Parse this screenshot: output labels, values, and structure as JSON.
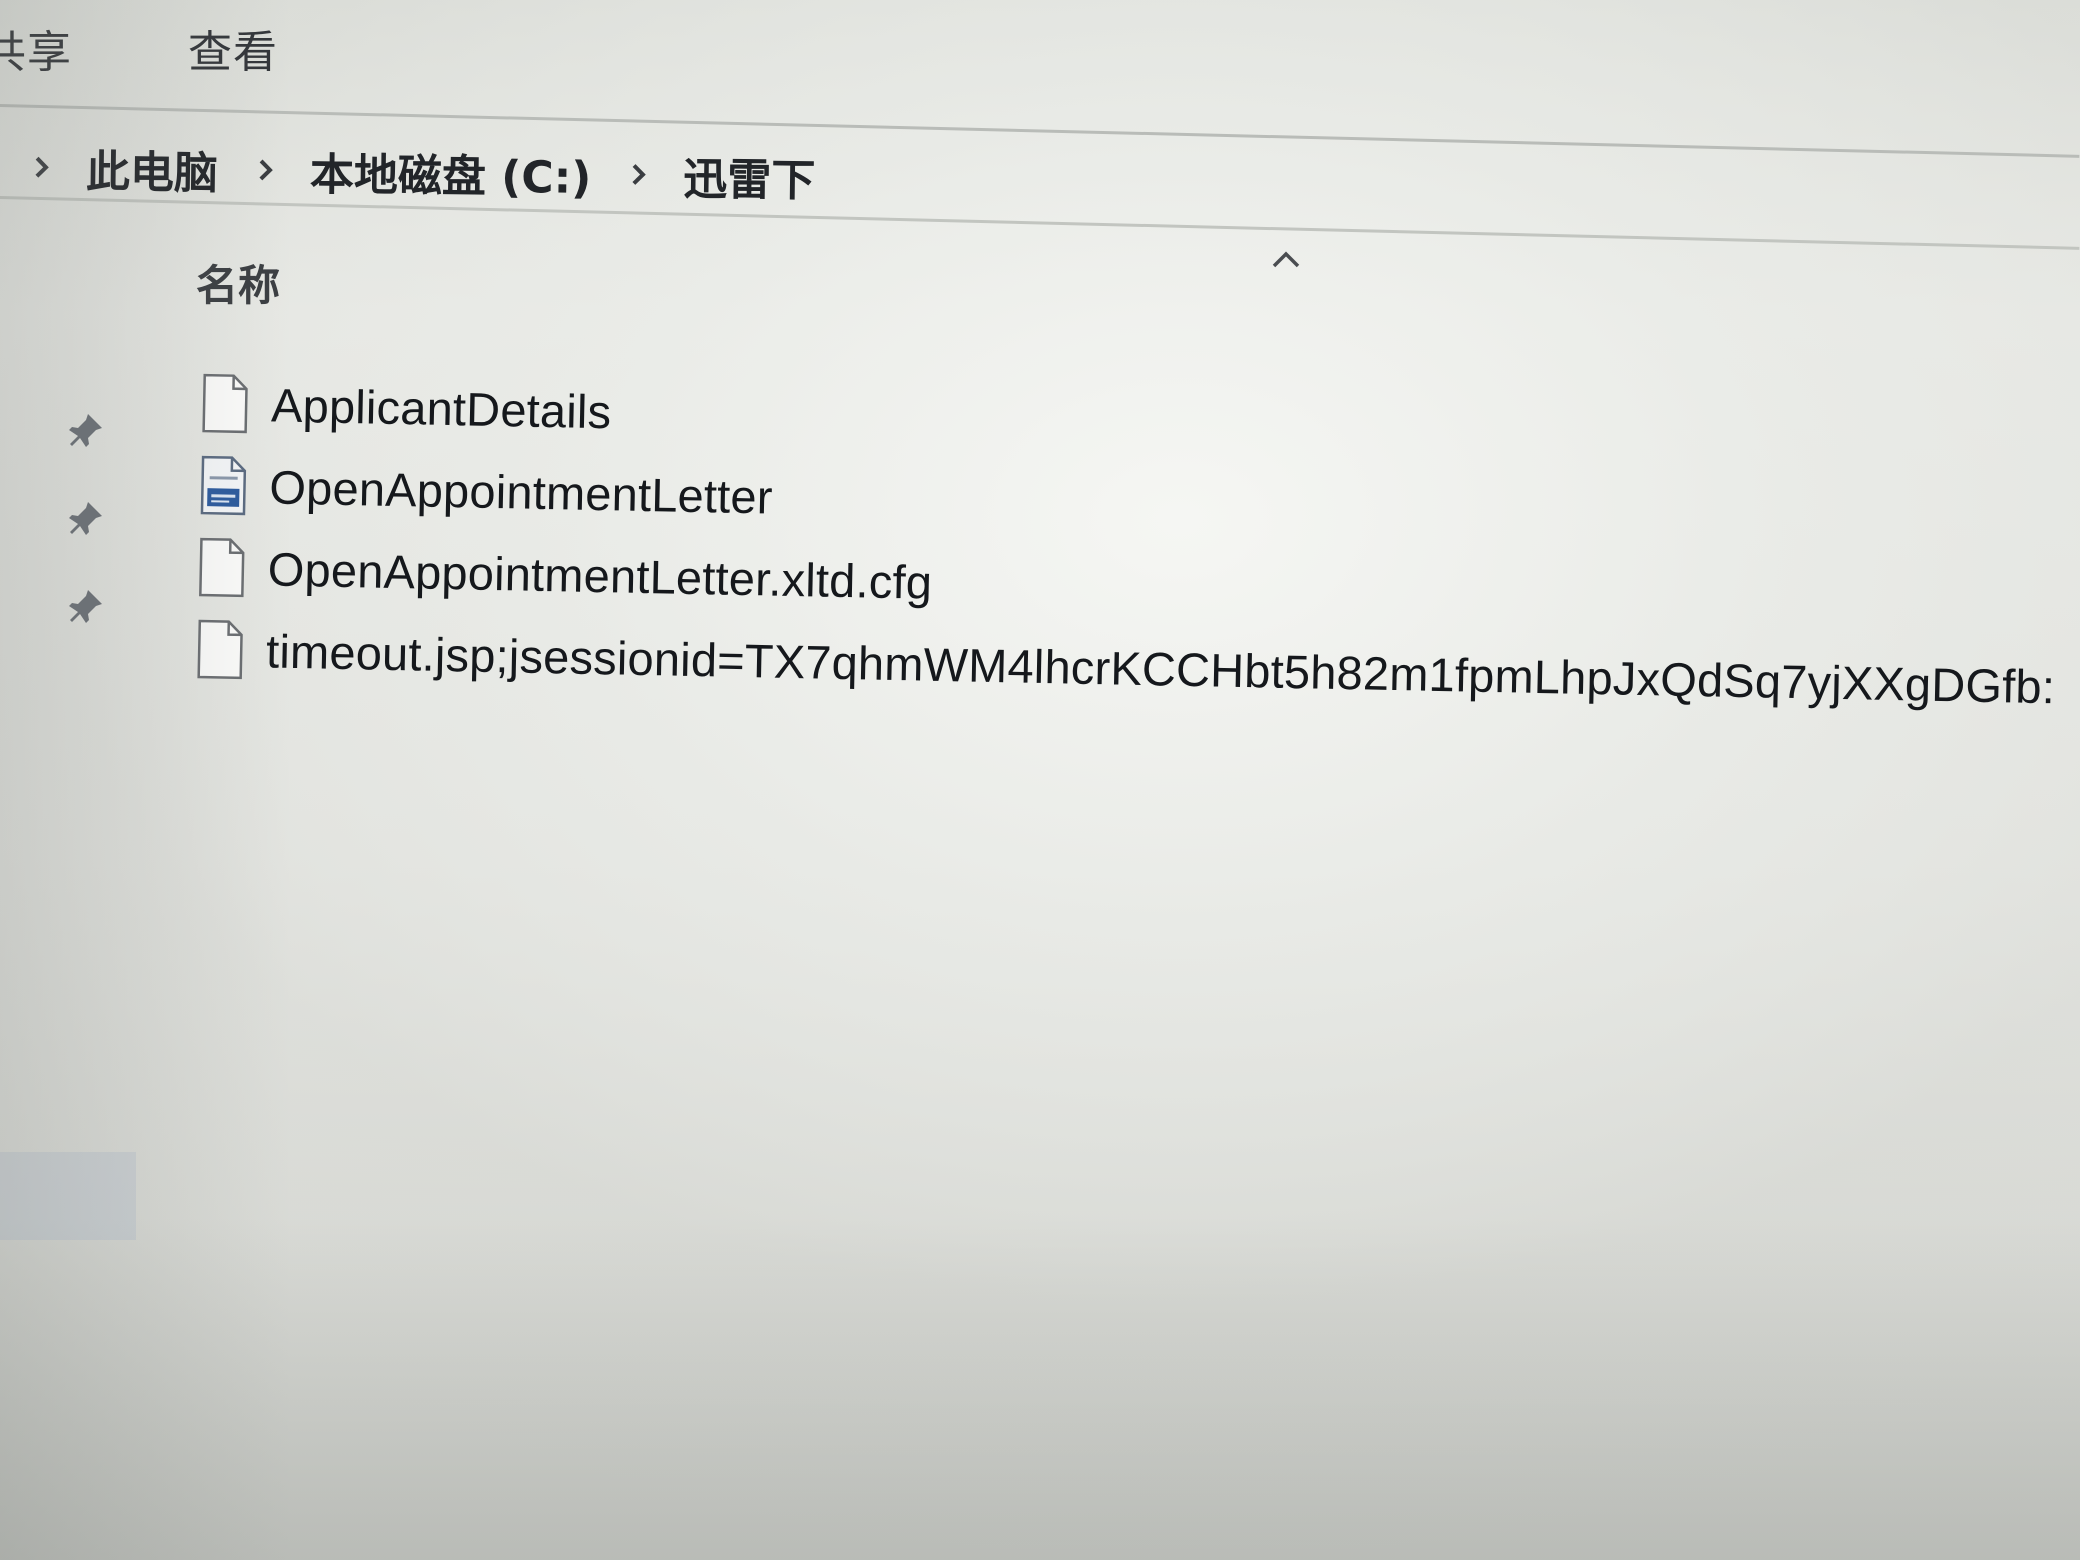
{
  "ribbon": {
    "tabs": [
      {
        "label": "共享"
      },
      {
        "label": "查看"
      }
    ]
  },
  "breadcrumb": {
    "items": [
      {
        "label": "此电脑"
      },
      {
        "label": "本地磁盘 (C:)"
      },
      {
        "label": "迅雷下"
      }
    ]
  },
  "file_list": {
    "column_header": "名称",
    "files": [
      {
        "name": "ApplicantDetails",
        "icon": "blank-file-icon"
      },
      {
        "name": "OpenAppointmentLetter",
        "icon": "document-file-icon"
      },
      {
        "name": "OpenAppointmentLetter.xltd.cfg",
        "icon": "blank-file-icon"
      },
      {
        "name": "timeout.jsp;jsessionid=TX7qhmWM4lhcrKCCHbt5h82m1fpmLhpJxQdSq7yjXXgDGfb:",
        "icon": "blank-file-icon"
      }
    ]
  },
  "colors": {
    "background": "#e6e7e3",
    "text": "#15181c",
    "document_icon_accent": "#2b5a9e"
  }
}
